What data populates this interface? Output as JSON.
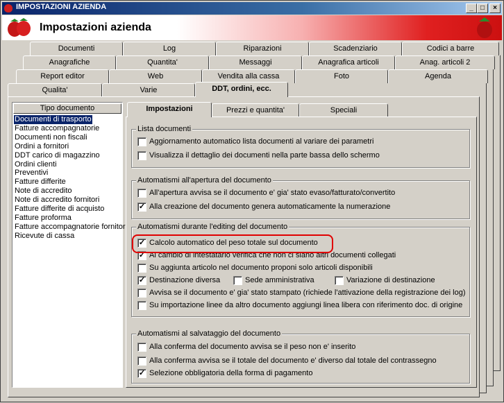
{
  "window": {
    "title": "IMPOSTAZIONI AZIENDA",
    "header": "Impostazioni azienda"
  },
  "caption_buttons": [
    "_",
    "□",
    "×"
  ],
  "tab_rows": [
    [
      "Documenti",
      "Log",
      "Riparazioni",
      "Scadenziario",
      "Codici a barre"
    ],
    [
      "Anagrafiche",
      "Quantita'",
      "Messaggi",
      "Anagrafica articoli",
      "Anag. articoli 2"
    ],
    [
      "Report editor",
      "Web",
      "Vendita alla cassa",
      "Foto",
      "Agenda"
    ],
    [
      "Qualita'",
      "Varie",
      "DDT, ordini, ecc."
    ]
  ],
  "doc_list": {
    "header": "Tipo documento",
    "items": [
      "Documenti di trasporto",
      "Fatture accompagnatorie",
      "Documenti non fiscali",
      "Ordini a fornitori",
      "DDT carico di magazzino",
      "Ordini clienti",
      "Preventivi",
      "Fatture differite",
      "Note di accredito",
      "Note di accredito fornitori",
      "Fatture differite di acquisto",
      "Fatture proforma",
      "Fatture accompagnatorie fornitori",
      "Ricevute di cassa"
    ],
    "selected": "Documenti di trasporto"
  },
  "inner_tabs": [
    "Impostazioni",
    "Prezzi e quantita'",
    "Speciali"
  ],
  "groups": {
    "g1": {
      "title": "Lista documenti",
      "items": [
        {
          "label": "Aggiornamento automatico lista documenti al variare dei parametri",
          "checked": false
        },
        {
          "label": "Visualizza il dettaglio dei documenti nella parte bassa dello schermo",
          "checked": false
        }
      ]
    },
    "g2": {
      "title": "Automatismi all'apertura del documento",
      "items": [
        {
          "label": "All'apertura avvisa se il documento e' gia' stato evaso/fatturato/convertito",
          "checked": false
        },
        {
          "label": "Alla creazione del documento genera automaticamente la numerazione",
          "checked": true
        }
      ]
    },
    "g3": {
      "title": "Automatismi durante l'editing del documento",
      "items": [
        {
          "label": "Calcolo automatico del peso totale sul documento",
          "checked": true
        },
        {
          "label": "Al cambio di intestatario verifica che non ci siano altri documenti collegati",
          "checked": true
        },
        {
          "label": "Su aggiunta articolo nel documento proponi solo articoli disponibili",
          "checked": false
        },
        {
          "label": "Destinazione diversa",
          "checked": true
        },
        {
          "label": "Sede amministrativa",
          "checked": false
        },
        {
          "label": "Variazione di destinazione",
          "checked": false
        },
        {
          "label": "Avvisa se il documento e' gia' stato stampato (richiede l'attivazione della registrazione dei log)",
          "checked": false
        },
        {
          "label": "Su importazione linee da altro documento aggiungi linea libera con riferimento doc. di origine",
          "checked": false
        }
      ]
    },
    "g4": {
      "title": "Automatismi al salvataggio del documento",
      "items": [
        {
          "label": "Alla conferma del documento avvisa se il peso non e' inserito",
          "checked": false
        },
        {
          "label": "Alla conferma avvisa se il totale del documento e' diverso dal totale del contrassegno",
          "checked": false
        },
        {
          "label": "Selezione obbligatoria della forma di pagamento",
          "checked": true
        }
      ]
    }
  },
  "colors": {
    "title_bar": "#0a246a",
    "selection": "#0a246a",
    "highlight_box": "#e00000",
    "banner_red": "#cc1010"
  }
}
